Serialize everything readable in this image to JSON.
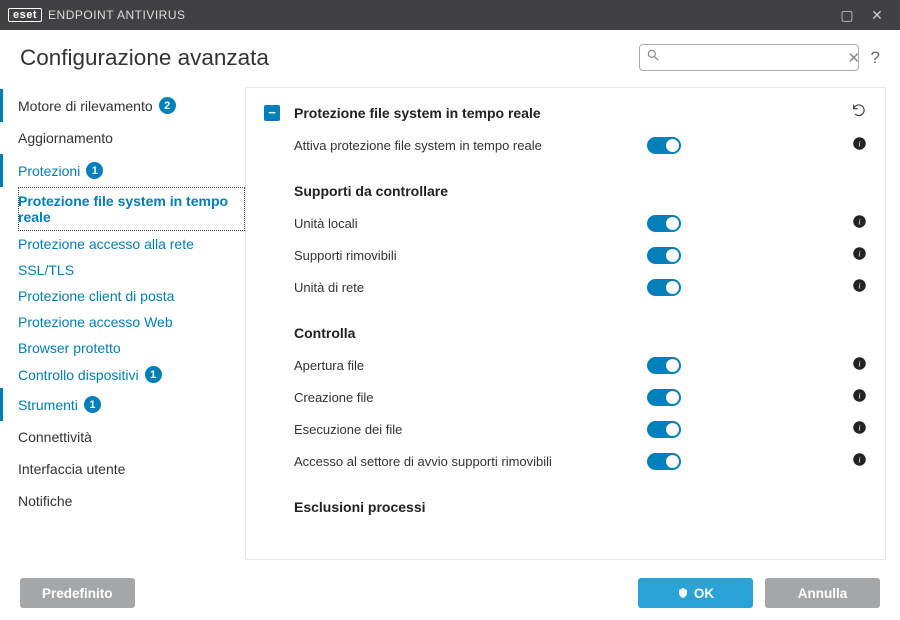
{
  "titlebar": {
    "brand": "eset",
    "product": "ENDPOINT ANTIVIRUS"
  },
  "page_title": "Configurazione avanzata",
  "search": {
    "placeholder": ""
  },
  "sidebar": {
    "items": [
      {
        "label": "Motore di rilevamento",
        "badge": "2"
      },
      {
        "label": "Aggiornamento"
      },
      {
        "label": "Protezioni",
        "badge": "1",
        "children": [
          {
            "label": "Protezione file system in tempo reale",
            "selected": true
          },
          {
            "label": "Protezione accesso alla rete"
          },
          {
            "label": "SSL/TLS"
          },
          {
            "label": "Protezione client di posta"
          },
          {
            "label": "Protezione accesso Web"
          },
          {
            "label": "Browser protetto"
          },
          {
            "label": "Controllo dispositivi",
            "badge": "1"
          }
        ]
      },
      {
        "label": "Strumenti",
        "badge": "1"
      },
      {
        "label": "Connettività"
      },
      {
        "label": "Interfaccia utente"
      },
      {
        "label": "Notifiche"
      }
    ]
  },
  "content": {
    "section_title": "Protezione file system in tempo reale",
    "activate_label": "Attiva protezione file system in tempo reale",
    "media_title": "Supporti da controllare",
    "media_items": [
      {
        "label": "Unità locali"
      },
      {
        "label": "Supporti rimovibili"
      },
      {
        "label": "Unità di rete"
      }
    ],
    "scan_title": "Controlla",
    "scan_items": [
      {
        "label": "Apertura file"
      },
      {
        "label": "Creazione file"
      },
      {
        "label": "Esecuzione dei file"
      },
      {
        "label": "Accesso al settore di avvio supporti rimovibili"
      }
    ],
    "excl_title": "Esclusioni processi"
  },
  "footer": {
    "default": "Predefinito",
    "ok": "OK",
    "cancel": "Annulla"
  }
}
